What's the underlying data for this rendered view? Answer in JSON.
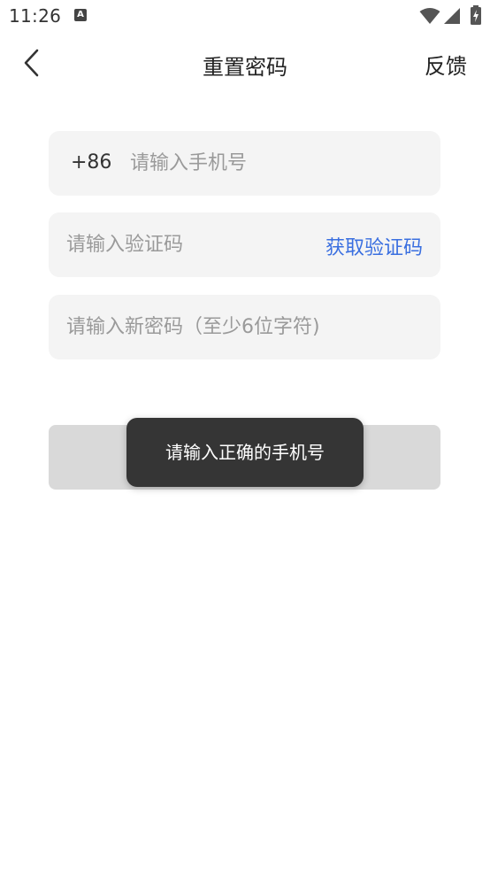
{
  "status_bar": {
    "time": "11:26",
    "notification_icon": "a-icon",
    "wifi_icon": "wifi-icon",
    "signal_icon": "signal-icon",
    "battery_icon": "battery-charging-icon"
  },
  "nav": {
    "back_icon": "back-chevron-icon",
    "title": "重置密码",
    "feedback_label": "反馈"
  },
  "form": {
    "phone": {
      "country_code": "+86",
      "value": "",
      "placeholder": "请输入手机号"
    },
    "code": {
      "value": "",
      "placeholder": "请输入验证码",
      "get_code_label": "获取验证码"
    },
    "password": {
      "value": "",
      "placeholder": "请输入新密码（至少6位字符)"
    }
  },
  "toast": {
    "message": "请输入正确的手机号"
  },
  "colors": {
    "accent": "#3a6fe0",
    "field_bg": "#f4f4f4",
    "button_disabled_bg": "#d9d9d9",
    "toast_bg": "#353535"
  }
}
